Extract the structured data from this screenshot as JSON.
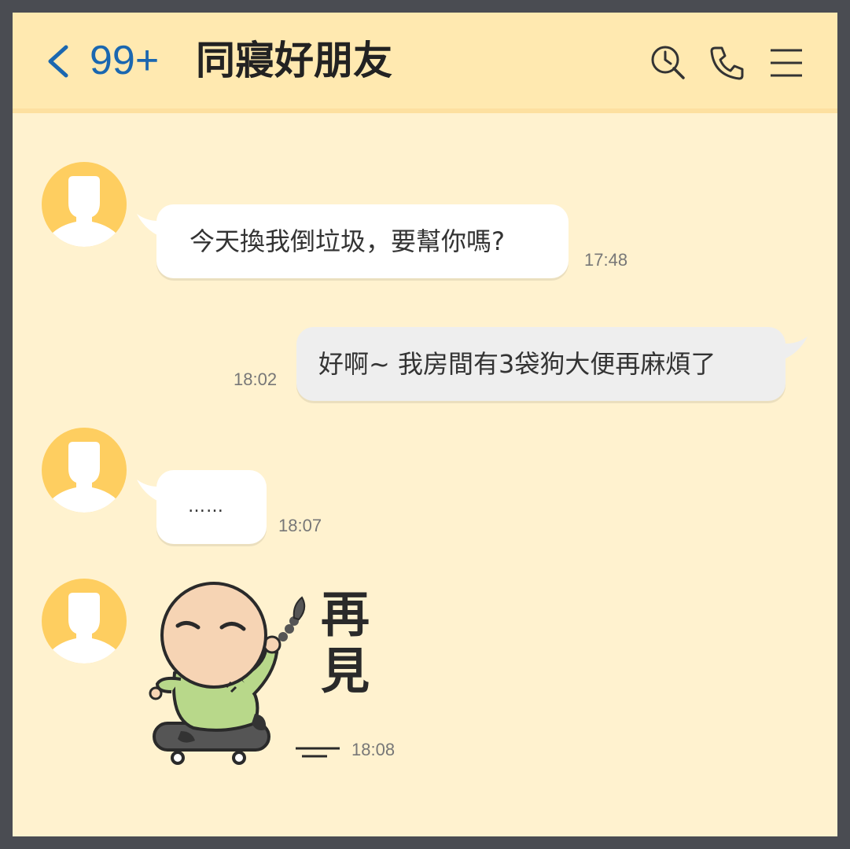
{
  "header": {
    "unread_count": "99+",
    "chat_title": "同寢好朋友",
    "icons": [
      "back-chevron-icon",
      "search-history-icon",
      "phone-icon",
      "menu-icon"
    ],
    "accent_color": "#1a67b0",
    "background_color": "#ffe9b0"
  },
  "messages": [
    {
      "side": "left",
      "text": "今天換我倒垃圾，要幫你嗎?",
      "time": "17:48"
    },
    {
      "side": "right",
      "text": "好啊~ 我房間有3袋狗大便再麻煩了",
      "time": "18:02"
    },
    {
      "side": "left",
      "text": "……",
      "time": "18:07"
    },
    {
      "side": "left",
      "sticker": {
        "text_line1": "再",
        "text_line2": "見"
      },
      "time": "18:08"
    }
  ]
}
